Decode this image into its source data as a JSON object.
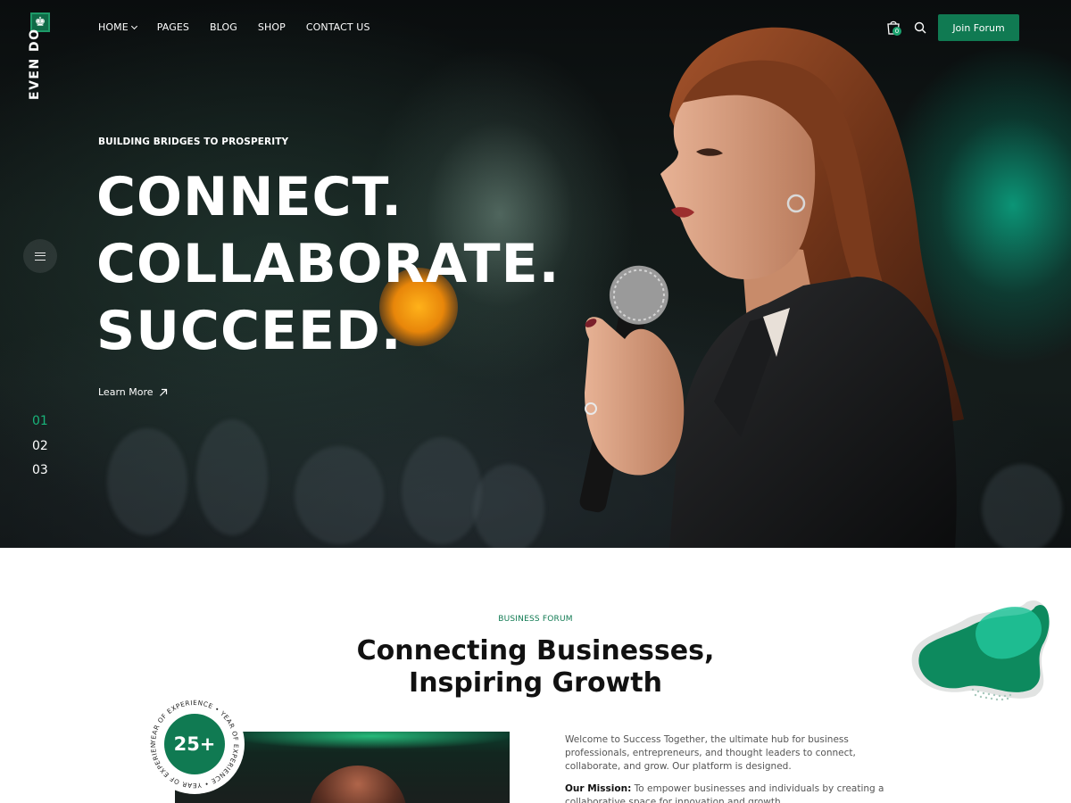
{
  "brand": {
    "logo_text": "EVEN DO",
    "accent": "#107a52",
    "accent_light": "#18b47a"
  },
  "nav": {
    "items": [
      {
        "label": "HOME",
        "has_dropdown": true
      },
      {
        "label": "PAGES"
      },
      {
        "label": "BLOG"
      },
      {
        "label": "SHOP"
      },
      {
        "label": "CONTACT US"
      }
    ],
    "cart_count": "0",
    "join_label": "Join Forum"
  },
  "hero": {
    "subtitle": "BUILDING BRIDGES TO PROSPERITY",
    "lines": [
      "CONNECT.",
      "COLLABORATE.",
      "SUCCEED."
    ],
    "learn_more": "Learn More",
    "slides": [
      "01",
      "02",
      "03"
    ],
    "active_slide": 0
  },
  "about": {
    "eyebrow": "BUSINESS FORUM",
    "title_lines": [
      "Connecting Businesses,",
      "Inspiring Growth"
    ],
    "experience_value": "25+",
    "experience_ring_text": "YEAR OF EXPERIENCE • YEAR OF EXPERIENCE • YEAR OF EXPERIENCE •",
    "intro": "Welcome to Success Together, the ultimate hub for business professionals, entrepreneurs, and thought leaders to connect, collaborate, and grow. Our platform is designed.",
    "mission_label": "Our Mission:",
    "mission_text": "To empower businesses and individuals by creating a collaborative space for innovation and growth."
  }
}
